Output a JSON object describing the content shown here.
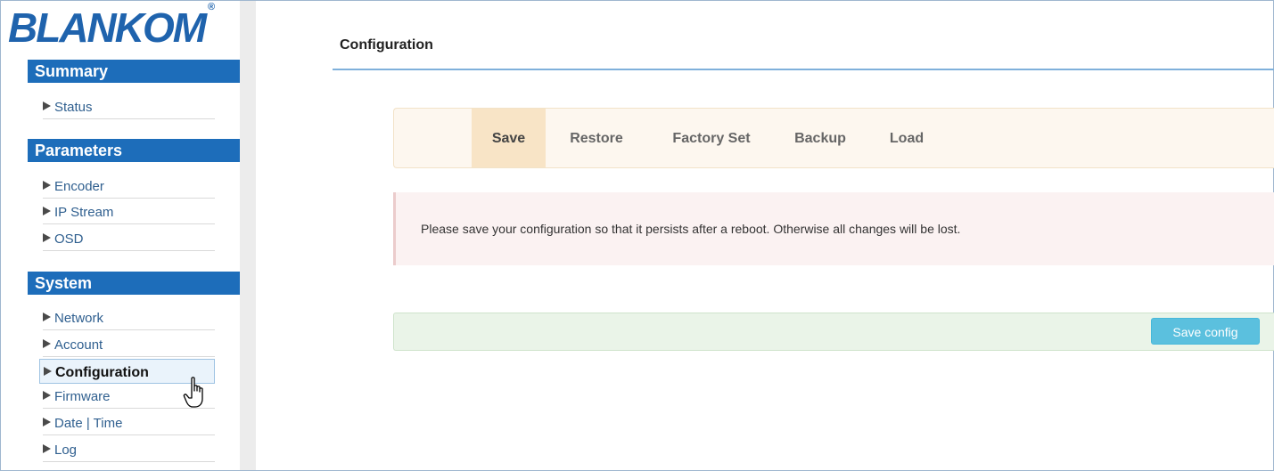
{
  "brand": {
    "logo_text": "BLANKOM",
    "reg_mark": "®",
    "color": "#1f63ad"
  },
  "sidebar": {
    "sections": [
      {
        "title": "Summary",
        "items": [
          "Status"
        ]
      },
      {
        "title": "Parameters",
        "items": [
          "Encoder",
          "IP Stream",
          "OSD"
        ]
      },
      {
        "title": "System",
        "items": [
          "Network",
          "Account",
          "Configuration",
          "Firmware",
          "Date | Time",
          "Log"
        ]
      }
    ],
    "active_item": "Configuration",
    "section_color": "#1d6dba"
  },
  "main": {
    "title": "Configuration",
    "tabs": [
      {
        "label": "Save",
        "active": true
      },
      {
        "label": "Restore",
        "active": false
      },
      {
        "label": "Factory Set",
        "active": false
      },
      {
        "label": "Backup",
        "active": false
      },
      {
        "label": "Load",
        "active": false
      }
    ],
    "alert_text": "Please save your configuration so that it persists after a reboot. Otherwise all changes will be lost.",
    "save_button_label": "Save config",
    "button_color": "#5bc0de"
  },
  "icons": {
    "nav_marker": "triangle-right-icon",
    "cursor": "hand-pointer-icon"
  }
}
